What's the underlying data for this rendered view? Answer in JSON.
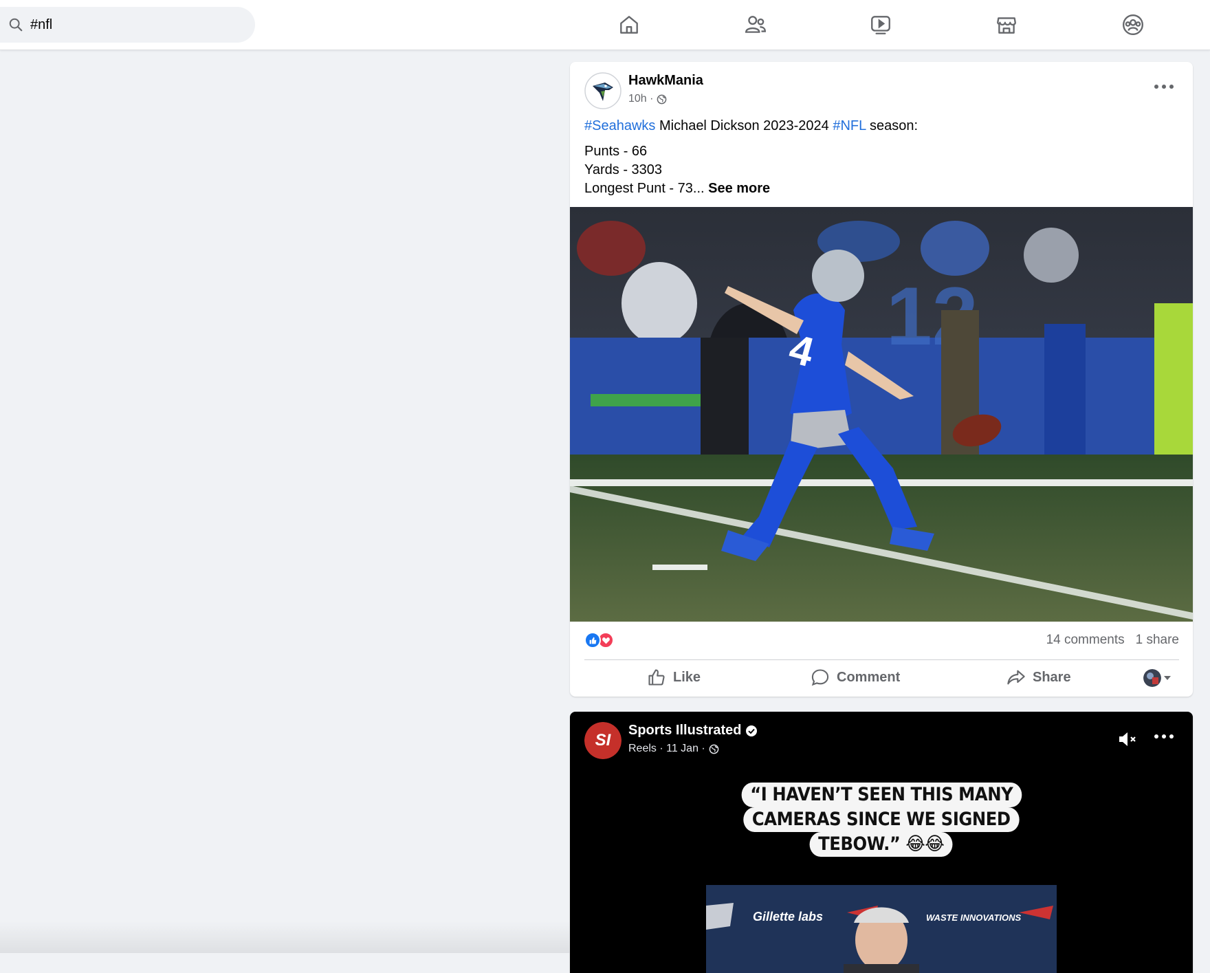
{
  "search": {
    "value": "#nfl",
    "icon": "search-icon"
  },
  "nav": [
    {
      "name": "home",
      "icon": "home-icon"
    },
    {
      "name": "friends",
      "icon": "friends-icon"
    },
    {
      "name": "watch",
      "icon": "video-icon"
    },
    {
      "name": "marketplace",
      "icon": "marketplace-icon"
    },
    {
      "name": "groups",
      "icon": "groups-icon"
    }
  ],
  "post1": {
    "author": "HawkMania",
    "time": "10h ·",
    "hashtag1": "#Seahawks",
    "text1": " Michael Dickson 2023-2024 ",
    "hashtag2": "#NFL",
    "text2": " season:",
    "line_punts": "Punts - 66",
    "line_yards": "Yards - 3303",
    "line_longest": "Longest Punt - 73...",
    "see_more": "See more",
    "comments": "14 comments",
    "shares": "1 share",
    "like_label": "Like",
    "comment_label": "Comment",
    "share_label": "Share"
  },
  "post2": {
    "author": "Sports Illustrated",
    "logo_text": "SI",
    "meta": "Reels · 11 Jan ·",
    "quote_line1": "“I HAVEN’T SEEN THIS MANY",
    "quote_line2": "CAMERAS SINCE WE SIGNED",
    "quote_line3": "TEBOW.” 😂😂",
    "banner_text1": "Gillette labs",
    "banner_text2": "WASTE INNOVATIONS"
  },
  "colors": {
    "hashtag": "#216fdb",
    "seahawks_blue": "#1d4ed8",
    "si_red": "#c5302a",
    "like_blue": "#1877f2",
    "love_red": "#f33e58"
  }
}
